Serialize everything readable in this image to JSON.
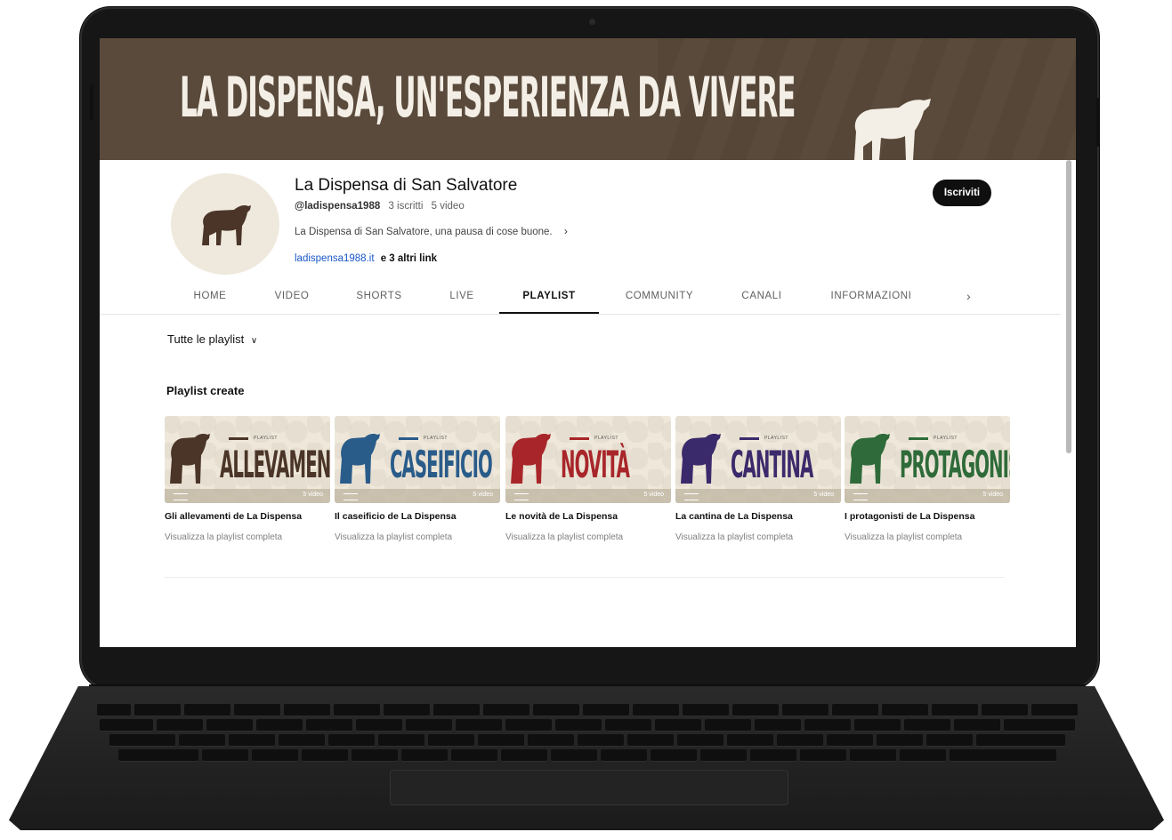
{
  "banner": {
    "title": "LA DISPENSA, UN'ESPERIENZA DA VIVERE"
  },
  "channel": {
    "name": "La Dispensa di San Salvatore",
    "handle": "@ladispensa1988",
    "subscribers": "3 iscritti",
    "videos": "5 video",
    "description": "La Dispensa di San Salvatore, una pausa di cose buone.",
    "link_url": "ladispensa1988.it",
    "link_more": "e 3 altri link",
    "subscribe_label": "Iscriviti"
  },
  "tabs": [
    {
      "label": "HOME"
    },
    {
      "label": "VIDEO"
    },
    {
      "label": "SHORTS"
    },
    {
      "label": "LIVE"
    },
    {
      "label": "PLAYLIST",
      "active": true
    },
    {
      "label": "COMMUNITY"
    },
    {
      "label": "CANALI"
    },
    {
      "label": "INFORMAZIONI"
    }
  ],
  "filter": {
    "label": "Tutte le playlist"
  },
  "section": {
    "title": "Playlist create"
  },
  "playlists": [
    {
      "thumb_word": "ALLEVAMENTI",
      "color": "#4a3528",
      "tag": "PLAYLIST",
      "count": "5 video",
      "title": "Gli allevamenti de La Dispensa",
      "subtitle": "Visualizza la playlist completa"
    },
    {
      "thumb_word": "CASEIFICIO",
      "color": "#2a5c8a",
      "tag": "PLAYLIST",
      "count": "5 video",
      "title": "Il caseificio de La Dispensa",
      "subtitle": "Visualizza la playlist completa"
    },
    {
      "thumb_word": "NOVITÀ",
      "color": "#a8262a",
      "tag": "PLAYLIST",
      "count": "5 video",
      "title": "Le novità de La Dispensa",
      "subtitle": "Visualizza la playlist completa"
    },
    {
      "thumb_word": "CANTINA",
      "color": "#3b2a6b",
      "tag": "PLAYLIST",
      "count": "5 video",
      "title": "La cantina de La Dispensa",
      "subtitle": "Visualizza la playlist completa"
    },
    {
      "thumb_word": "PROTAGONISTI",
      "color": "#2f6b3a",
      "tag": "PLAYLIST",
      "count": "5 video",
      "title": "I protagonisti de La Dispensa",
      "subtitle": "Visualizza la playlist completa"
    }
  ],
  "colors": {
    "banner_bg": "#5a4a3b",
    "banner_text": "#f4efe6",
    "avatar_bg": "#efe9dd",
    "link": "#1a56c8"
  }
}
